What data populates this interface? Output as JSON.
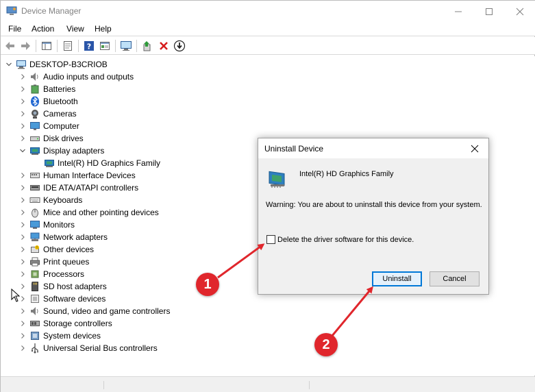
{
  "window": {
    "title": "Device Manager"
  },
  "menu": [
    "File",
    "Action",
    "View",
    "Help"
  ],
  "toolbar": {
    "buttons": [
      "back-arrow-icon",
      "forward-arrow-icon",
      "show-hide-console-tree-icon",
      "properties-icon",
      "help-icon",
      "view-icon",
      "monitor-scan-icon",
      "update-driver-icon",
      "uninstall-x-icon",
      "download-icon"
    ]
  },
  "tree": {
    "root": "DESKTOP-B3CRIOB",
    "categories": [
      {
        "label": "Audio inputs and outputs",
        "icon": "speaker-icon",
        "expanded": false
      },
      {
        "label": "Batteries",
        "icon": "battery-icon",
        "expanded": false
      },
      {
        "label": "Bluetooth",
        "icon": "bluetooth-icon",
        "expanded": false
      },
      {
        "label": "Cameras",
        "icon": "camera-icon",
        "expanded": false
      },
      {
        "label": "Computer",
        "icon": "computer-icon",
        "expanded": false
      },
      {
        "label": "Disk drives",
        "icon": "disk-drive-icon",
        "expanded": false
      },
      {
        "label": "Display adapters",
        "icon": "display-adapter-icon",
        "expanded": true,
        "children": [
          "Intel(R) HD Graphics Family"
        ]
      },
      {
        "label": "Human Interface Devices",
        "icon": "hid-icon",
        "expanded": false
      },
      {
        "label": "IDE ATA/ATAPI controllers",
        "icon": "ide-controller-icon",
        "expanded": false
      },
      {
        "label": "Keyboards",
        "icon": "keyboard-icon",
        "expanded": false
      },
      {
        "label": "Mice and other pointing devices",
        "icon": "mouse-icon",
        "expanded": false
      },
      {
        "label": "Monitors",
        "icon": "monitor-icon",
        "expanded": false
      },
      {
        "label": "Network adapters",
        "icon": "network-adapter-icon",
        "expanded": false
      },
      {
        "label": "Other devices",
        "icon": "other-devices-icon",
        "expanded": false
      },
      {
        "label": "Print queues",
        "icon": "printer-icon",
        "expanded": false
      },
      {
        "label": "Processors",
        "icon": "processor-icon",
        "expanded": false
      },
      {
        "label": "SD host adapters",
        "icon": "sd-card-icon",
        "expanded": false
      },
      {
        "label": "Software devices",
        "icon": "software-device-icon",
        "expanded": false
      },
      {
        "label": "Sound, video and game controllers",
        "icon": "speaker-icon",
        "expanded": false
      },
      {
        "label": "Storage controllers",
        "icon": "storage-controller-icon",
        "expanded": false
      },
      {
        "label": "System devices",
        "icon": "system-device-icon",
        "expanded": false
      },
      {
        "label": "Universal Serial Bus controllers",
        "icon": "usb-icon",
        "expanded": false
      }
    ]
  },
  "dialog": {
    "title": "Uninstall Device",
    "device_name": "Intel(R) HD Graphics Family",
    "warning": "Warning: You are about to uninstall this device from your system.",
    "checkbox_label": "Delete the driver software for this device.",
    "checkbox_checked": false,
    "uninstall_label": "Uninstall",
    "cancel_label": "Cancel"
  },
  "callouts": [
    "1",
    "2"
  ],
  "colors": {
    "accent": "#0078d7",
    "callout": "#e0262c"
  }
}
